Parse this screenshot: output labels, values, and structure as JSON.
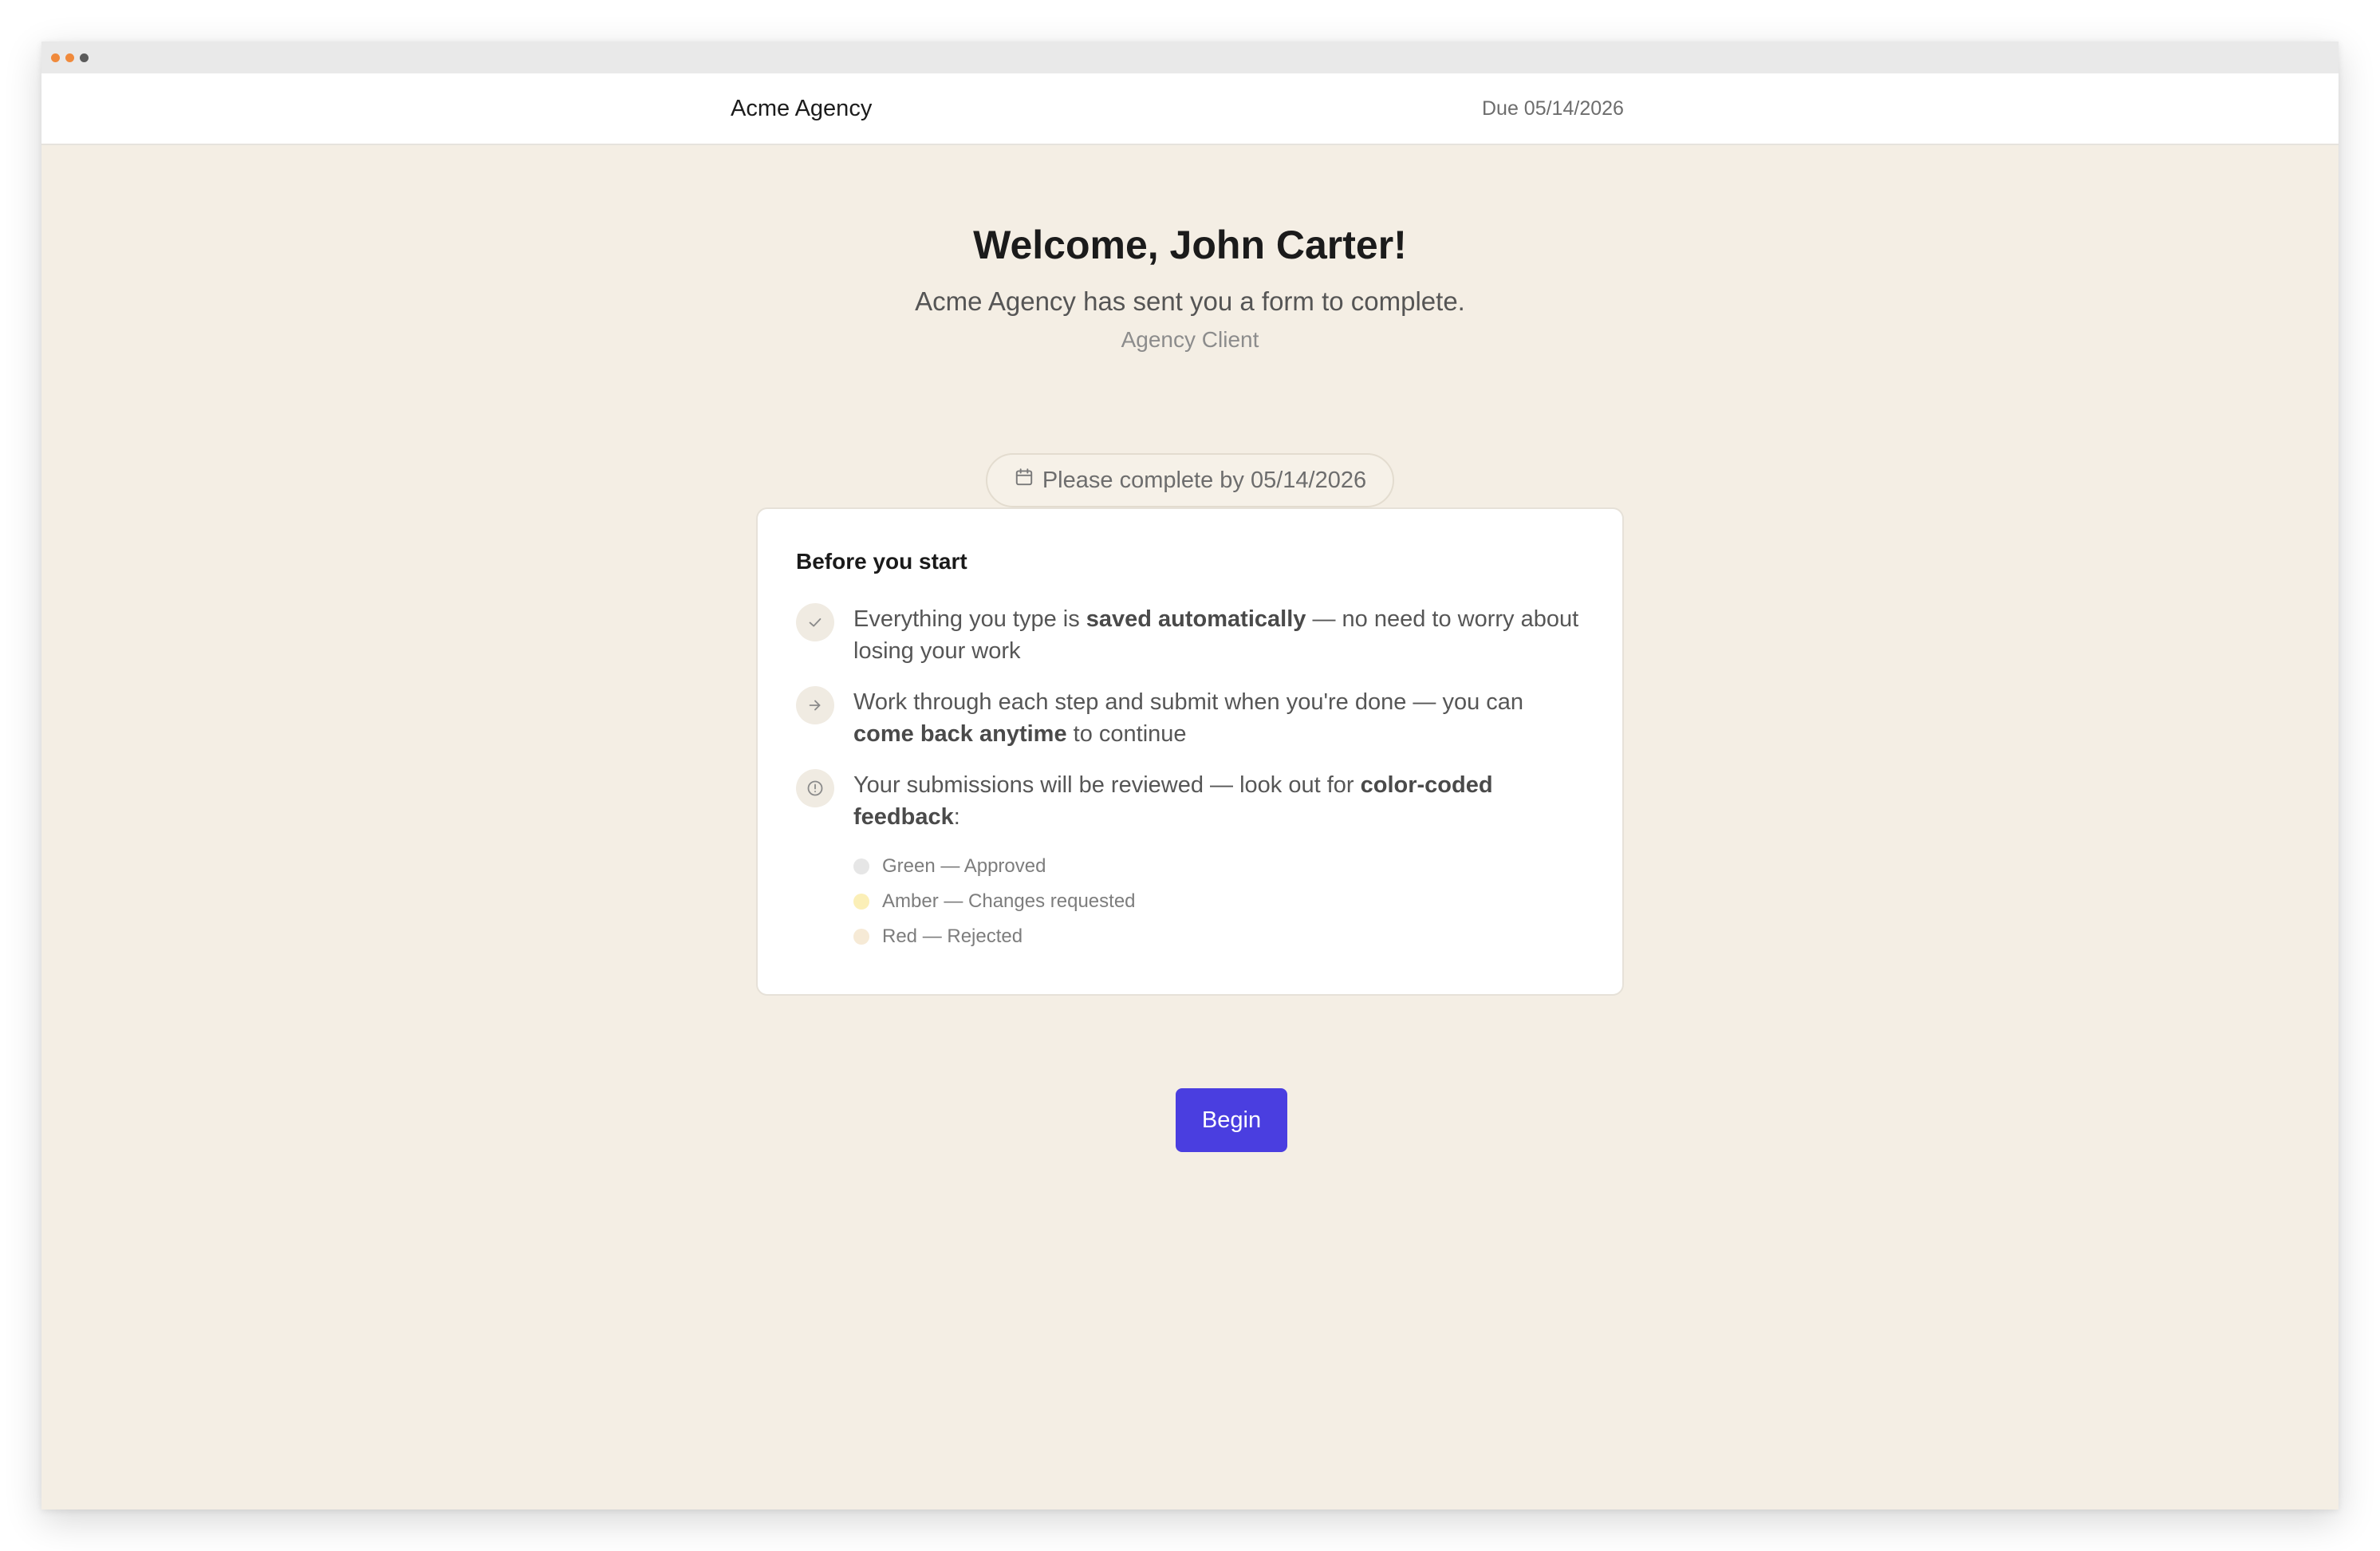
{
  "window": {
    "dot_colors": [
      "#f08a3c",
      "#f08a3c",
      "#5a5a5a"
    ]
  },
  "header": {
    "brand": "Acme Agency",
    "due": "Due 05/14/2026"
  },
  "hero": {
    "welcome": "Welcome, John Carter!",
    "subtitle": "Acme Agency has sent you a form to complete.",
    "role": "Agency Client"
  },
  "due_pill": {
    "icon": "calendar-icon",
    "label": "Please complete by 05/14/2026"
  },
  "card": {
    "title": "Before you start",
    "items": [
      {
        "icon": "check-icon",
        "before": "Everything you type is ",
        "bold": "saved automatically",
        "after": " — no need to worry about losing your work"
      },
      {
        "icon": "arrow-right-icon",
        "before": "Work through each step and submit when you're done — you can ",
        "bold": "come back anytime",
        "after": " to continue"
      },
      {
        "icon": "info-icon",
        "before": "Your submissions will be reviewed — look out for ",
        "bold": "color-coded feedback",
        "after": ":"
      }
    ],
    "legend": [
      {
        "label": "Green — Approved",
        "color": "#e6e6e6"
      },
      {
        "label": "Amber — Changes requested",
        "color": "#fbefb7"
      },
      {
        "label": "Red — Rejected",
        "color": "#f6ead6"
      }
    ]
  },
  "begin_button": {
    "label": "Begin",
    "color": "#4a3ee0"
  }
}
